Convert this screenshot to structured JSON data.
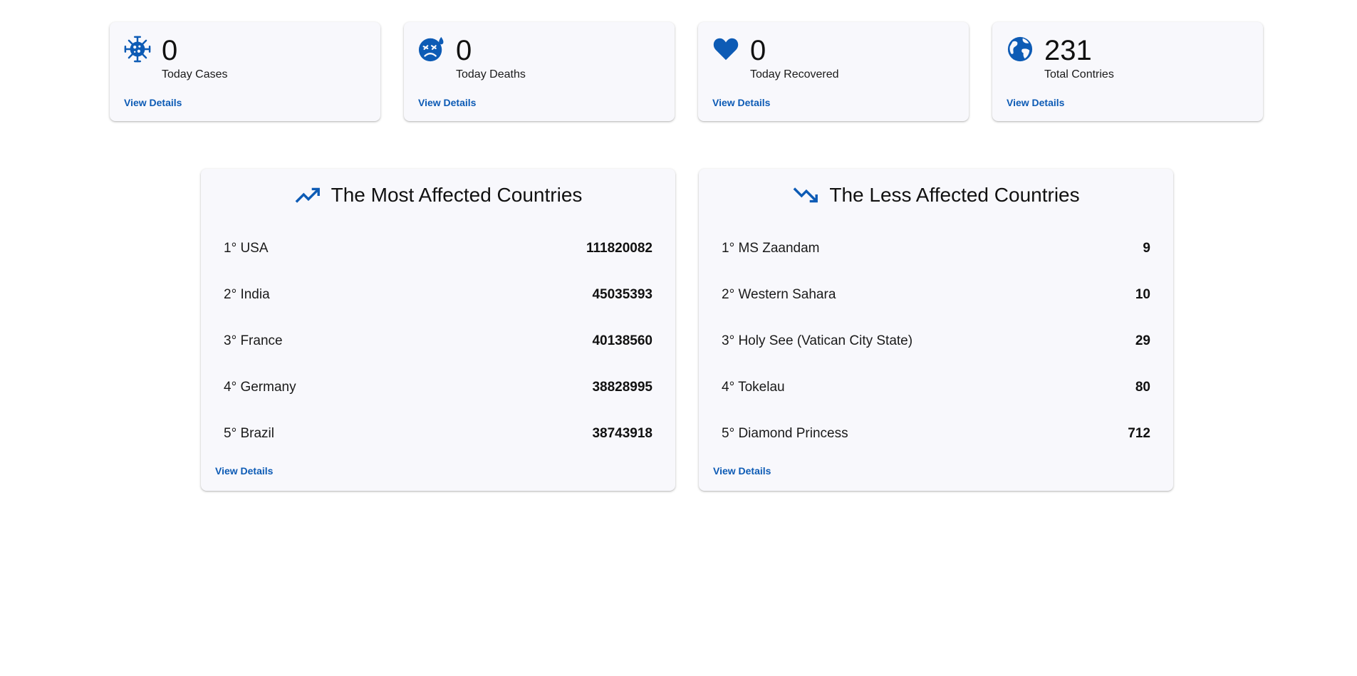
{
  "stats": [
    {
      "icon": "virus-icon",
      "value": "0",
      "label": "Today Cases",
      "link": "View Details"
    },
    {
      "icon": "sad-face-icon",
      "value": "0",
      "label": "Today Deaths",
      "link": "View Details"
    },
    {
      "icon": "heart-icon",
      "value": "0",
      "label": "Today Recovered",
      "link": "View Details"
    },
    {
      "icon": "globe-icon",
      "value": "231",
      "label": "Total Contries",
      "link": "View Details"
    }
  ],
  "most_affected": {
    "icon": "trending-up-icon",
    "title": "The Most Affected Countries",
    "items": [
      {
        "name": "1° USA",
        "count": "111820082"
      },
      {
        "name": "2° India",
        "count": "45035393"
      },
      {
        "name": "3° France",
        "count": "40138560"
      },
      {
        "name": "4° Germany",
        "count": "38828995"
      },
      {
        "name": "5° Brazil",
        "count": "38743918"
      }
    ],
    "link": "View Details"
  },
  "less_affected": {
    "icon": "trending-down-icon",
    "title": "The Less Affected Countries",
    "items": [
      {
        "name": "1° MS Zaandam",
        "count": "9"
      },
      {
        "name": "2° Western Sahara",
        "count": "10"
      },
      {
        "name": "3° Holy See (Vatican City State)",
        "count": "29"
      },
      {
        "name": "4° Tokelau",
        "count": "80"
      },
      {
        "name": "5° Diamond Princess",
        "count": "712"
      }
    ],
    "link": "View Details"
  },
  "colors": {
    "accent": "#0d5bb5",
    "card_background": "#f8f8fc"
  }
}
